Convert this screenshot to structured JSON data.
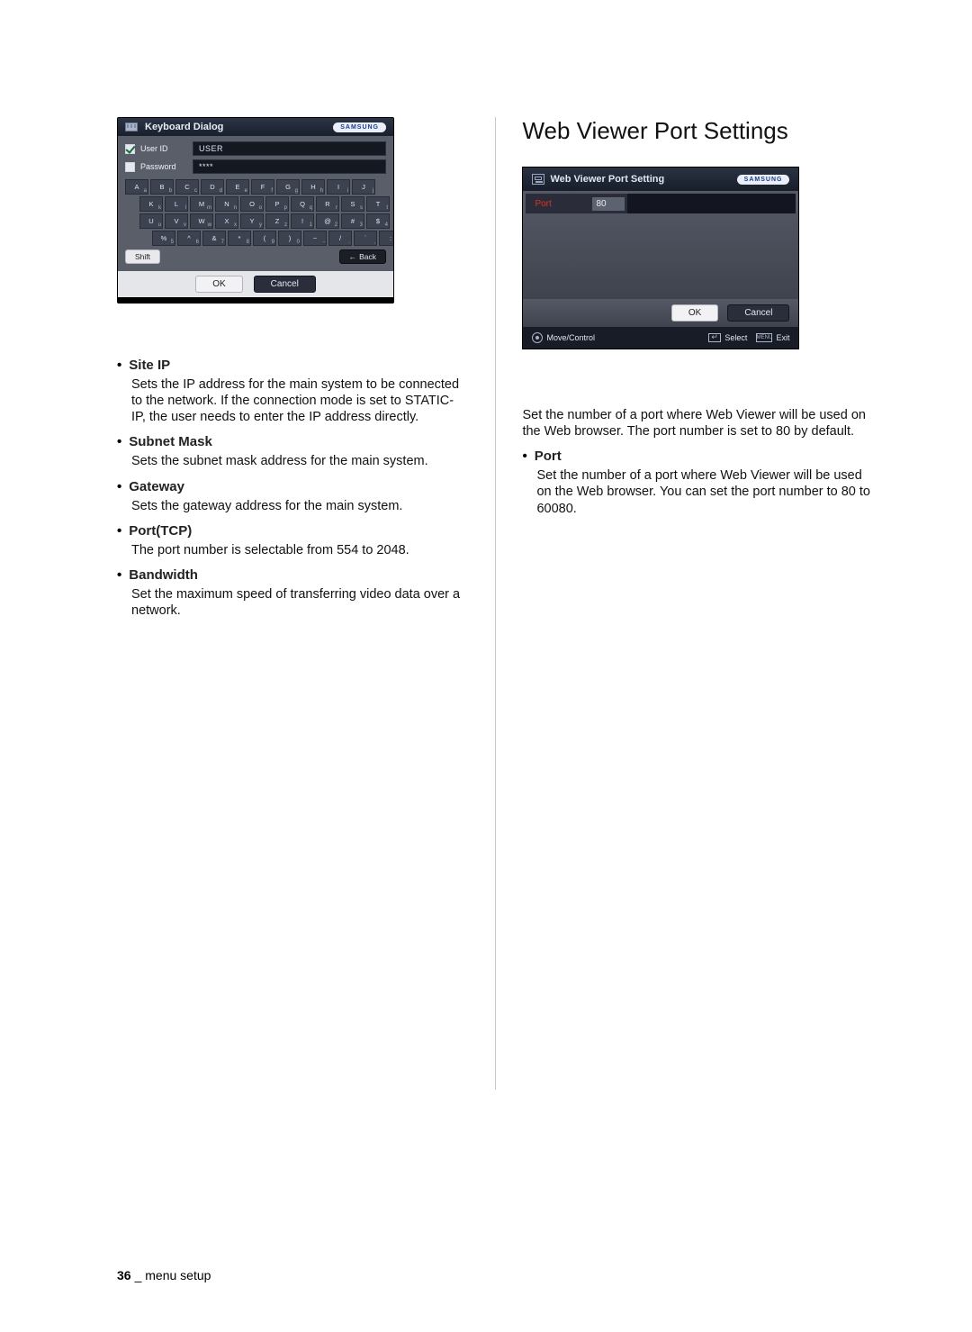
{
  "footer": {
    "page": "36",
    "section": "menu setup",
    "joiner": "_"
  },
  "kbdlg": {
    "title": "Keyboard Dialog",
    "brand": "SAMSUNG",
    "fields": {
      "userid": {
        "label": "User ID",
        "value": "USER",
        "checked": true
      },
      "password": {
        "label": "Password",
        "value": "****",
        "checked": false
      }
    },
    "rows": [
      [
        {
          "m": "A",
          "s": "a"
        },
        {
          "m": "B",
          "s": "b"
        },
        {
          "m": "C",
          "s": "c"
        },
        {
          "m": "D",
          "s": "d"
        },
        {
          "m": "E",
          "s": "e"
        },
        {
          "m": "F",
          "s": "f"
        },
        {
          "m": "G",
          "s": "g"
        },
        {
          "m": "H",
          "s": "h"
        },
        {
          "m": "I",
          "s": "i"
        },
        {
          "m": "J",
          "s": "j"
        }
      ],
      [
        {
          "m": "K",
          "s": "k"
        },
        {
          "m": "L",
          "s": "l"
        },
        {
          "m": "M",
          "s": "m"
        },
        {
          "m": "N",
          "s": "n"
        },
        {
          "m": "O",
          "s": "o"
        },
        {
          "m": "P",
          "s": "p"
        },
        {
          "m": "Q",
          "s": "q"
        },
        {
          "m": "R",
          "s": "r"
        },
        {
          "m": "S",
          "s": "s"
        },
        {
          "m": "T",
          "s": "t"
        }
      ],
      [
        {
          "m": "U",
          "s": "u"
        },
        {
          "m": "V",
          "s": "v"
        },
        {
          "m": "W",
          "s": "w"
        },
        {
          "m": "X",
          "s": "x"
        },
        {
          "m": "Y",
          "s": "y"
        },
        {
          "m": "Z",
          "s": "z"
        },
        {
          "m": "!",
          "s": "1"
        },
        {
          "m": "@",
          "s": "2"
        },
        {
          "m": "#",
          "s": "3"
        },
        {
          "m": "$",
          "s": "4"
        }
      ],
      [
        {
          "m": "%",
          "s": "5"
        },
        {
          "m": "^",
          "s": "6"
        },
        {
          "m": "&",
          "s": "7"
        },
        {
          "m": "*",
          "s": "8"
        },
        {
          "m": "(",
          "s": "9"
        },
        {
          "m": ")",
          "s": "0"
        },
        {
          "m": "~",
          "s": "-"
        },
        {
          "m": "/",
          "s": "."
        },
        {
          "m": "`",
          "s": ","
        },
        {
          "m": ":",
          "s": ";"
        }
      ]
    ],
    "shift": "Shift",
    "back": "Back",
    "ok": "OK",
    "cancel": "Cancel"
  },
  "portdlg": {
    "title": "Web Viewer Port Setting",
    "brand": "SAMSUNG",
    "port_label": "Port",
    "port_value": "80",
    "ok": "OK",
    "cancel": "Cancel",
    "move": "Move/Control",
    "select": "Select",
    "exit": "Exit",
    "menu": "MENU"
  },
  "left": {
    "items": [
      {
        "title": "Site IP",
        "desc": "Sets the IP address for the main system to be connected to the network. If the connection mode is set to STATIC-IP, the user needs to enter the IP address directly."
      },
      {
        "title": "Subnet Mask",
        "desc": "Sets the subnet mask address for the main system."
      },
      {
        "title": "Gateway",
        "desc": "Sets the gateway address for the main system."
      },
      {
        "title": "Port(TCP)",
        "desc": "The port number is selectable from 554 to 2048."
      },
      {
        "title": "Bandwidth",
        "desc": "Set the maximum speed of transferring video data over a network."
      }
    ]
  },
  "right": {
    "heading": "Web Viewer Port Settings",
    "lead": "Set the number of a port where Web Viewer will be used on the Web browser. The port number is set to 80 by default.",
    "items": [
      {
        "title": "Port",
        "desc": "Set the number of a port where Web Viewer will be used on the Web browser. You can set the port number to 80 to 60080."
      }
    ]
  }
}
